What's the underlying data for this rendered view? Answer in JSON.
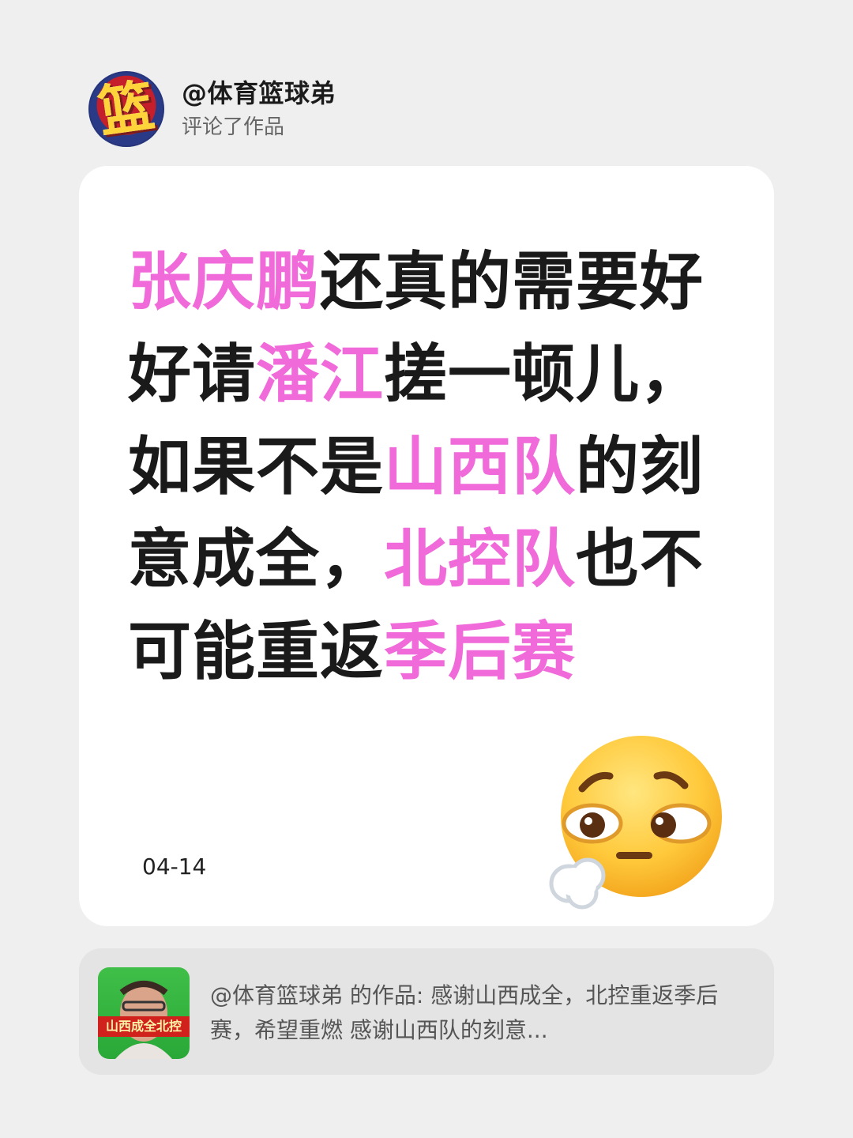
{
  "header": {
    "username": "@体育篮球弟",
    "action": "评论了作品",
    "avatar_text": "篮"
  },
  "comment": {
    "segments": [
      {
        "text": "张庆鹏",
        "highlight": true
      },
      {
        "text": "还真的需要好好请",
        "highlight": false
      },
      {
        "text": "潘江",
        "highlight": true
      },
      {
        "text": "搓一顿儿，如果不是",
        "highlight": false
      },
      {
        "text": "山西队",
        "highlight": true
      },
      {
        "text": "的刻意成全，",
        "highlight": false
      },
      {
        "text": "北控队",
        "highlight": true
      },
      {
        "text": "也不可能重返",
        "highlight": false
      },
      {
        "text": "季后赛",
        "highlight": true
      }
    ],
    "date": "04-14"
  },
  "emoji": {
    "icon": "face-exhaling-emoji"
  },
  "reference": {
    "thumbnail_caption": "山西成全北控",
    "text": "@体育篮球弟 的作品: 感谢山西成全，北控重返季后赛，希望重燃 感谢山西队的刻意..."
  },
  "colors": {
    "highlight": "#f06ad9",
    "text": "#1a1a1a",
    "background": "#efefef",
    "card": "#ffffff",
    "reference_background": "#e4e4e4"
  }
}
